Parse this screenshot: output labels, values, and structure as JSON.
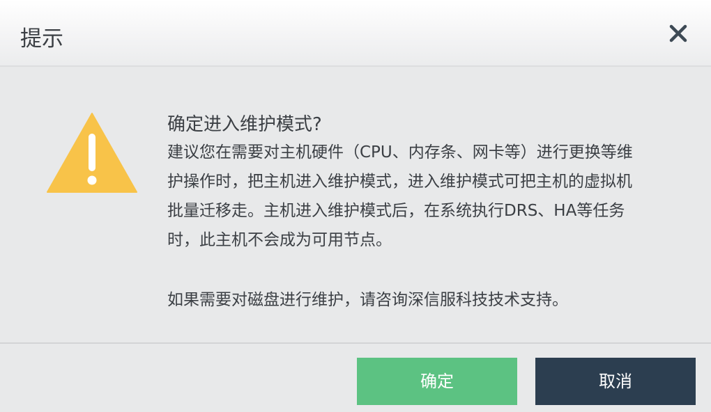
{
  "dialog": {
    "title": "提示",
    "close_icon": "close-icon",
    "warning_icon": "warning-icon",
    "warning_color": "#f8c349",
    "heading": "确定进入维护模式?",
    "paragraph_lines": [
      "建议您在需要对主机硬件（CPU、内存条、网卡等）进行更换等维",
      "护操作时，把主机进入维护模式，进入维护模式可把主机的虚拟机",
      "批量迁移走。主机进入维护模式后，在系统执行DRS、HA等任务",
      "时，此主机不会成为可用节点。"
    ],
    "note": "如果需要对磁盘进行维护，请咨询深信服科技技术支持。",
    "ok_label": "确定",
    "cancel_label": "取消",
    "ok_color": "#5cc282",
    "cancel_color": "#2c3e50"
  }
}
